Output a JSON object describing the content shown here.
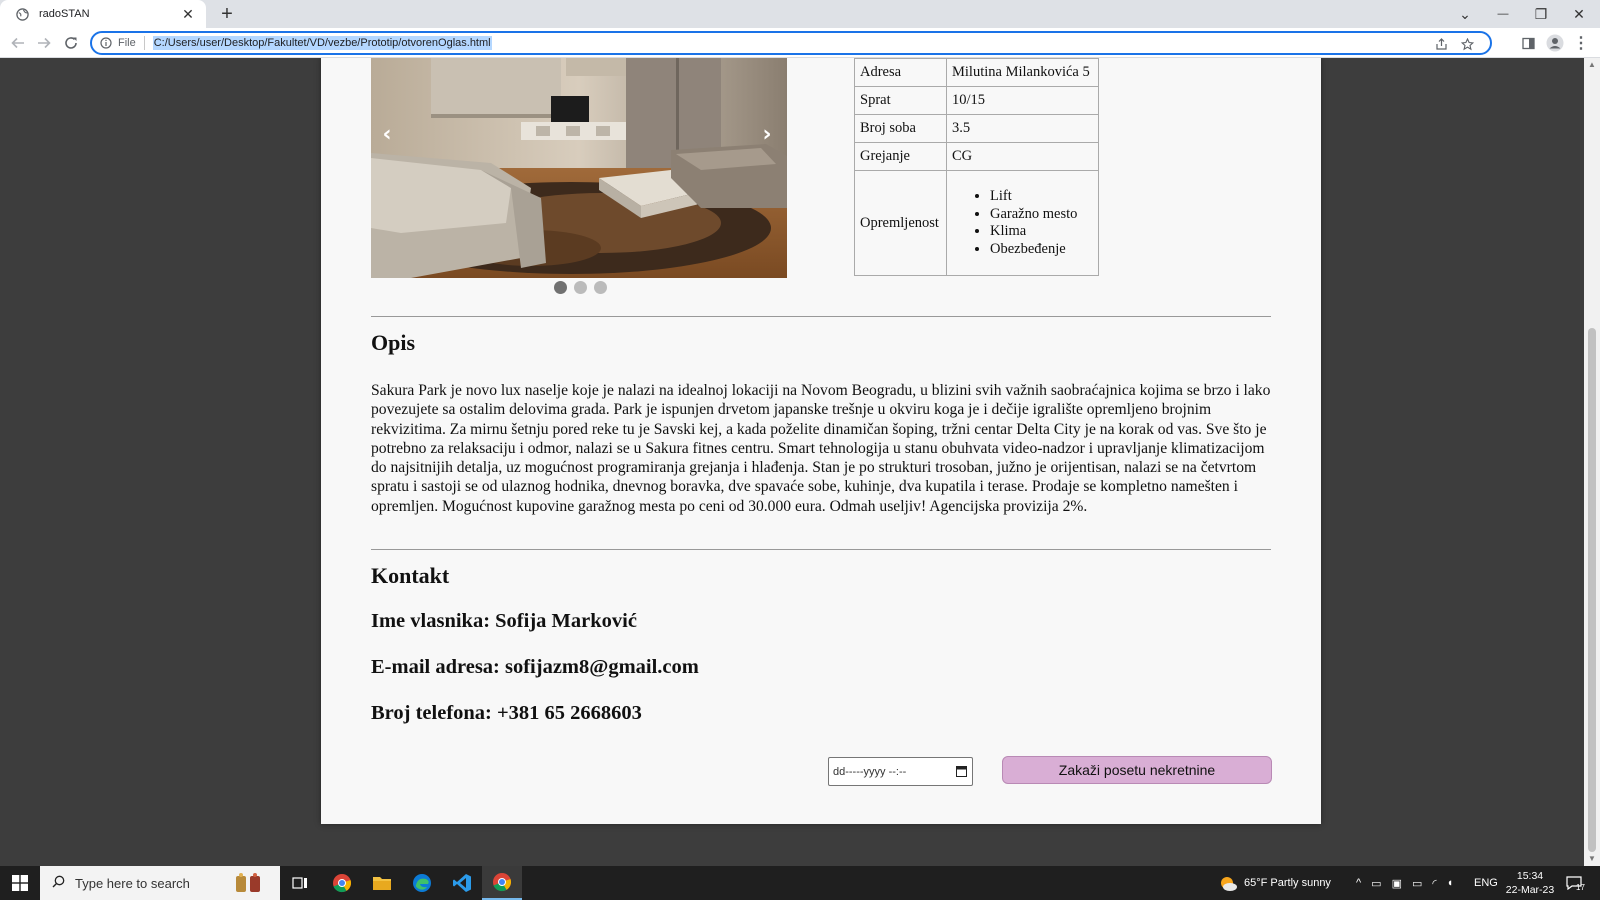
{
  "browser": {
    "tab_title": "radoSTAN",
    "tab_close": "✕",
    "new_tab": "+",
    "site_info_label": "File",
    "url": "C:/Users/user/Desktop/Fakultet/VD/vezbe/Prototip/otvorenOglas.html",
    "window_controls": {
      "chevron": "⌄",
      "minimize": "—",
      "restore": "❐",
      "close": "✕"
    }
  },
  "slider": {
    "prev_label": "‹",
    "next_label": "›",
    "dots": 3,
    "active_dot": 1
  },
  "details": {
    "rows": [
      {
        "label": "Adresa",
        "value": "Milutina Milankovića 5"
      },
      {
        "label": "Sprat",
        "value": "10/15"
      },
      {
        "label": "Broj soba",
        "value": "3.5"
      },
      {
        "label": "Grejanje",
        "value": "CG"
      }
    ],
    "equipment_label": "Opremljenost",
    "equipment": [
      "Lift",
      "Garažno mesto",
      "Klima",
      "Obezbeđenje"
    ]
  },
  "description": {
    "heading": "Opis",
    "text": "Sakura Park je novo lux naselje koje je nalazi na idealnoj lokaciji na Novom Beogradu, u blizini svih važnih saobraćajnica kojima se brzo i lako povezujete sa ostalim delovima grada. Park je ispunjen drvetom japanske trešnje u okviru koga je i dečije igralište opremljeno brojnim rekvizitima. Za mirnu šetnju pored reke tu je Savski kej, a kada poželite dinamičan šoping, tržni centar Delta City je na korak od vas. Sve što je potrebno za relaksaciju i odmor, nalazi se u Sakura fitnes centru. Smart tehnologija u stanu obuhvata video-nadzor i upravljanje klimatizacijom do najsitnijih detalja, uz mogućnost programiranja grejanja i hlađenja. Stan je po strukturi trosoban, južno je orijentisan, nalazi se na četvrtom spratu i sastoji se od ulaznog hodnika, dnevnog boravka, dve spavaće sobe, kuhinje, dva kupatila i terase. Prodaje se kompletno namešten i opremljen. Mogućnost kupovine garažnog mesta po ceni od 30.000 eura. Odmah useljiv! Agencijska provizija 2%."
  },
  "contact": {
    "heading": "Kontakt",
    "owner": "Ime vlasnika: Sofija Marković",
    "email": "E-mail adresa: sofijazm8@gmail.com",
    "phone": "Broj telefona: +381 65 2668603"
  },
  "booking": {
    "date_placeholder": "dd-----yyyy --:--",
    "button_label": "Zakaži posetu nekretnine"
  },
  "taskbar": {
    "search_placeholder": "Type here to search",
    "weather": "65°F  Partly sunny",
    "language": "ENG",
    "time": "15:34",
    "date": "22-Mar-23",
    "notifications": "17"
  }
}
